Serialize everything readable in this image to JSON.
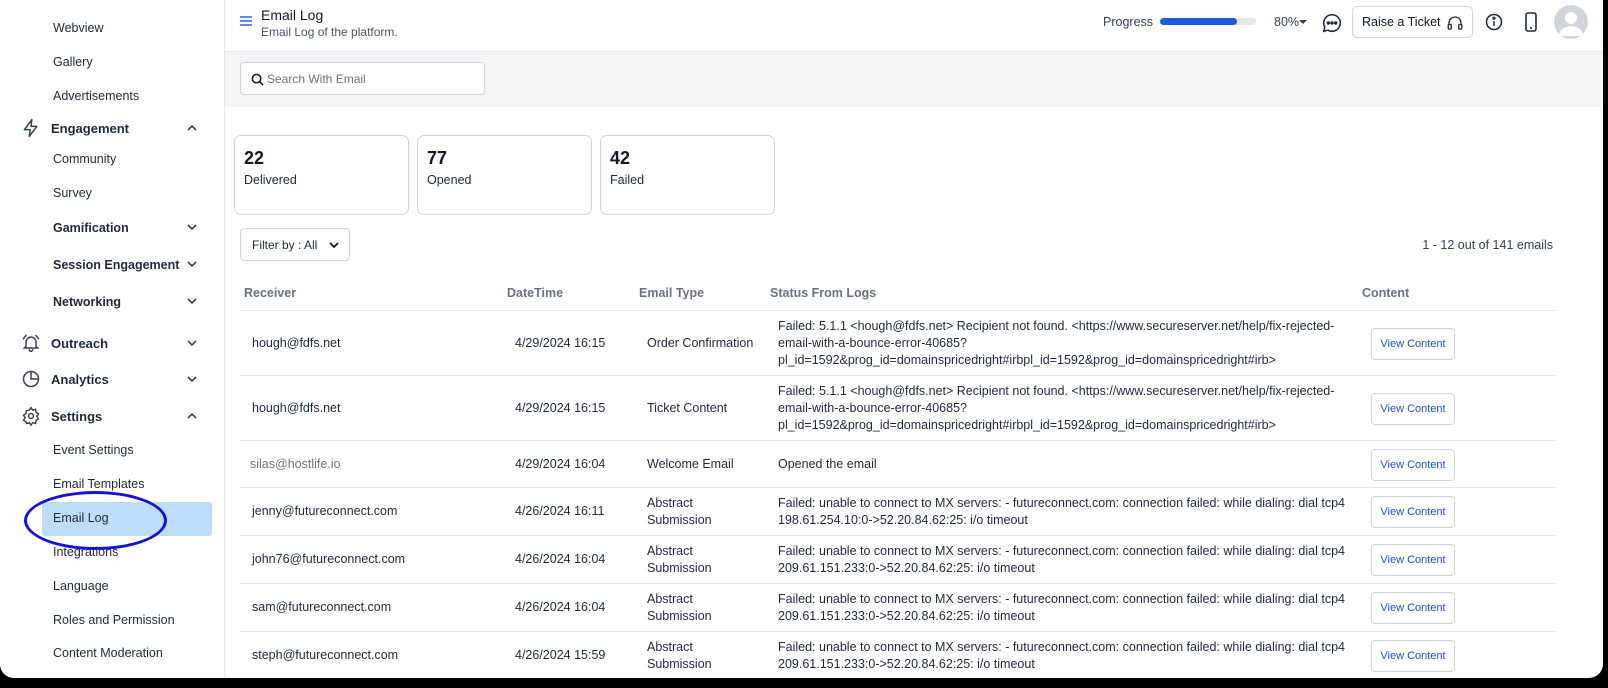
{
  "colors": {
    "accent": "#1d5bdb",
    "active_bg": "#bfdcfb",
    "annotation": "#1414d4",
    "link": "#1d4ed8"
  },
  "sidebar": {
    "items": [
      {
        "label": "Webview",
        "type": "sub"
      },
      {
        "label": "Gallery",
        "type": "sub"
      },
      {
        "label": "Advertisements",
        "type": "sub"
      },
      {
        "label": "Engagement",
        "type": "section",
        "icon": "lightning-icon",
        "expanded": true
      },
      {
        "label": "Community",
        "type": "sub"
      },
      {
        "label": "Survey",
        "type": "sub"
      },
      {
        "label": "Gamification",
        "type": "group",
        "expanded": false
      },
      {
        "label": "Session Engagement",
        "type": "group",
        "expanded": false
      },
      {
        "label": "Networking",
        "type": "group",
        "expanded": false
      },
      {
        "label": "Outreach",
        "type": "section",
        "icon": "bell-icon",
        "expanded": false
      },
      {
        "label": "Analytics",
        "type": "section",
        "icon": "pie-chart-icon",
        "expanded": false
      },
      {
        "label": "Settings",
        "type": "section",
        "icon": "gear-icon",
        "expanded": true
      },
      {
        "label": "Event Settings",
        "type": "sub"
      },
      {
        "label": "Email Templates",
        "type": "sub"
      },
      {
        "label": "Email Log",
        "type": "sub",
        "active": true
      },
      {
        "label": "Integrations",
        "type": "sub"
      },
      {
        "label": "Language",
        "type": "sub"
      },
      {
        "label": "Roles and Permission",
        "type": "sub"
      },
      {
        "label": "Content Moderation",
        "type": "sub"
      }
    ]
  },
  "header": {
    "title": "Email Log",
    "subtitle": "Email Log of the platform.",
    "progress_label": "Progress",
    "progress_value": 80,
    "progress_text": "80%",
    "raise_ticket_label": "Raise a Ticket"
  },
  "search": {
    "placeholder": "Search With Email",
    "value": ""
  },
  "stats": [
    {
      "value": "22",
      "label": "Delivered"
    },
    {
      "value": "77",
      "label": "Opened"
    },
    {
      "value": "42",
      "label": "Failed"
    }
  ],
  "filter": {
    "label": "Filter by : All"
  },
  "count_label": "1 - 12 out of 141 emails",
  "table": {
    "columns": [
      "Receiver",
      "DateTime",
      "Email Type",
      "Status From Logs",
      "Content"
    ],
    "button_label": "View Content",
    "rows": [
      {
        "receiver": "hough@fdfs.net",
        "datetime": "4/29/2024 16:15",
        "type_lines": [
          "Order Confirmation"
        ],
        "status_lines": [
          "Failed: 5.1.1 <hough@fdfs.net> Recipient not found. <https://www.secureserver.net/help/fix-rejected-",
          "email-with-a-bounce-error-40685?",
          "pl_id=1592&prog_id=domainspricedright#irbpl_id=1592&prog_id=domainspricedright#irb>"
        ]
      },
      {
        "receiver": "hough@fdfs.net",
        "datetime": "4/29/2024 16:15",
        "type_lines": [
          "Ticket Content"
        ],
        "status_lines": [
          "Failed: 5.1.1 <hough@fdfs.net> Recipient not found. <https://www.secureserver.net/help/fix-rejected-",
          "email-with-a-bounce-error-40685?",
          "pl_id=1592&prog_id=domainspricedright#irbpl_id=1592&prog_id=domainspricedright#irb>"
        ]
      },
      {
        "receiver": "silas@hostlife.io",
        "datetime": "4/29/2024 16:04",
        "type_lines": [
          "Welcome Email"
        ],
        "status_lines": [
          "Opened the email"
        ]
      },
      {
        "receiver": "jenny@futureconnect.com",
        "datetime": "4/26/2024 16:11",
        "type_lines": [
          "Abstract",
          "Submission"
        ],
        "status_lines": [
          "Failed: unable to connect to MX servers: - futureconnect.com: connection failed: while dialing: dial tcp4",
          "198.61.254.10:0->52.20.84.62:25: i/o timeout"
        ]
      },
      {
        "receiver": "john76@futureconnect.com",
        "datetime": "4/26/2024 16:04",
        "type_lines": [
          "Abstract",
          "Submission"
        ],
        "status_lines": [
          "Failed: unable to connect to MX servers: - futureconnect.com: connection failed: while dialing: dial tcp4",
          "209.61.151.233:0->52.20.84.62:25: i/o timeout"
        ]
      },
      {
        "receiver": "sam@futureconnect.com",
        "datetime": "4/26/2024 16:04",
        "type_lines": [
          "Abstract",
          "Submission"
        ],
        "status_lines": [
          "Failed: unable to connect to MX servers: - futureconnect.com: connection failed: while dialing: dial tcp4",
          "209.61.151.233:0->52.20.84.62:25: i/o timeout"
        ]
      },
      {
        "receiver": "steph@futureconnect.com",
        "datetime": "4/26/2024 15:59",
        "type_lines": [
          "Abstract",
          "Submission"
        ],
        "status_lines": [
          "Failed: unable to connect to MX servers: - futureconnect.com: connection failed: while dialing: dial tcp4",
          "209.61.151.233:0->52.20.84.62:25: i/o timeout"
        ]
      }
    ]
  }
}
